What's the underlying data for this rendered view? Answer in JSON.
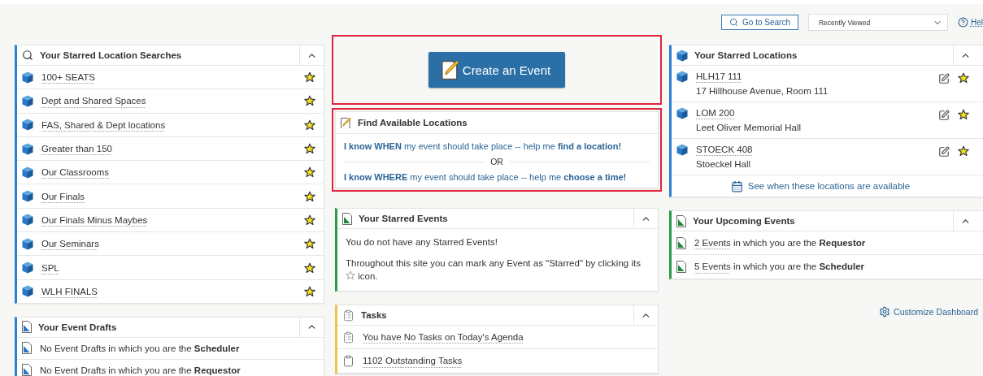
{
  "toolbar": {
    "search_button": "Go to Search",
    "view_select": {
      "value": "Recently Viewed"
    },
    "help_link": "Hel"
  },
  "starred_searches": {
    "title": "Your Starred Location Searches",
    "expanded": true,
    "items": [
      {
        "label": "100+ SEATS",
        "starred": true
      },
      {
        "label": "Dept and Shared Spaces",
        "starred": true
      },
      {
        "label": "FAS, Shared & Dept locations",
        "starred": true
      },
      {
        "label": "Greater than 150",
        "starred": true
      },
      {
        "label": "Our Classrooms",
        "starred": true
      },
      {
        "label": "Our Finals",
        "starred": true
      },
      {
        "label": "Our Finals Minus Maybes",
        "starred": true
      },
      {
        "label": "Our Seminars",
        "starred": true
      },
      {
        "label": "SPL",
        "starred": true
      },
      {
        "label": "WLH FINALS",
        "starred": true
      }
    ]
  },
  "event_drafts": {
    "title": "Your Event Drafts",
    "expanded": true,
    "items": [
      {
        "text": "No Event Drafts in which you are the **Scheduler**"
      },
      {
        "text": "No Event Drafts in which you are the **Requestor**"
      }
    ]
  },
  "create_event": {
    "label": "Create an Event",
    "highlighted": true
  },
  "find_locations": {
    "title": "Find Available Locations",
    "highlighted": true,
    "separator": "OR",
    "options": [
      {
        "text": "**I know WHEN** my event should take place -- help me **find a location!**"
      },
      {
        "text": "**I know WHERE** my event should take place -- help me **choose a time!**"
      }
    ]
  },
  "starred_events": {
    "title": "Your Starred Events",
    "expanded": true,
    "empty_message": "You do not have any Starred Events!",
    "hint_before": "Throughout this site you can mark any Event as \"Starred\" by clicking its",
    "hint_after": "icon."
  },
  "tasks": {
    "title": "Tasks",
    "expanded": true,
    "items": [
      {
        "kind": "agenda",
        "text": "You have No Tasks on Today's Agenda"
      },
      {
        "kind": "outstanding",
        "text": "1102 Outstanding Tasks"
      }
    ]
  },
  "starred_locations": {
    "title": "Your Starred Locations",
    "expanded": true,
    "items": [
      {
        "name": "HLH17 111",
        "address": "17 Hillhouse Avenue, Room 111",
        "starred": true
      },
      {
        "name": "LOM 200",
        "address": "Leet Oliver Memorial Hall",
        "starred": true
      },
      {
        "name": "STOECK 408",
        "address": "Stoeckel Hall",
        "starred": true
      }
    ],
    "footer_link": "See when these locations are available"
  },
  "upcoming_events": {
    "title": "Your Upcoming Events",
    "expanded": true,
    "items": [
      {
        "link": "2 Events",
        "text": "in which you are the **Requestor**"
      },
      {
        "link": "5 Events",
        "text": "in which you are the **Scheduler**"
      }
    ]
  },
  "customize_link": "Customize Dashboard"
}
